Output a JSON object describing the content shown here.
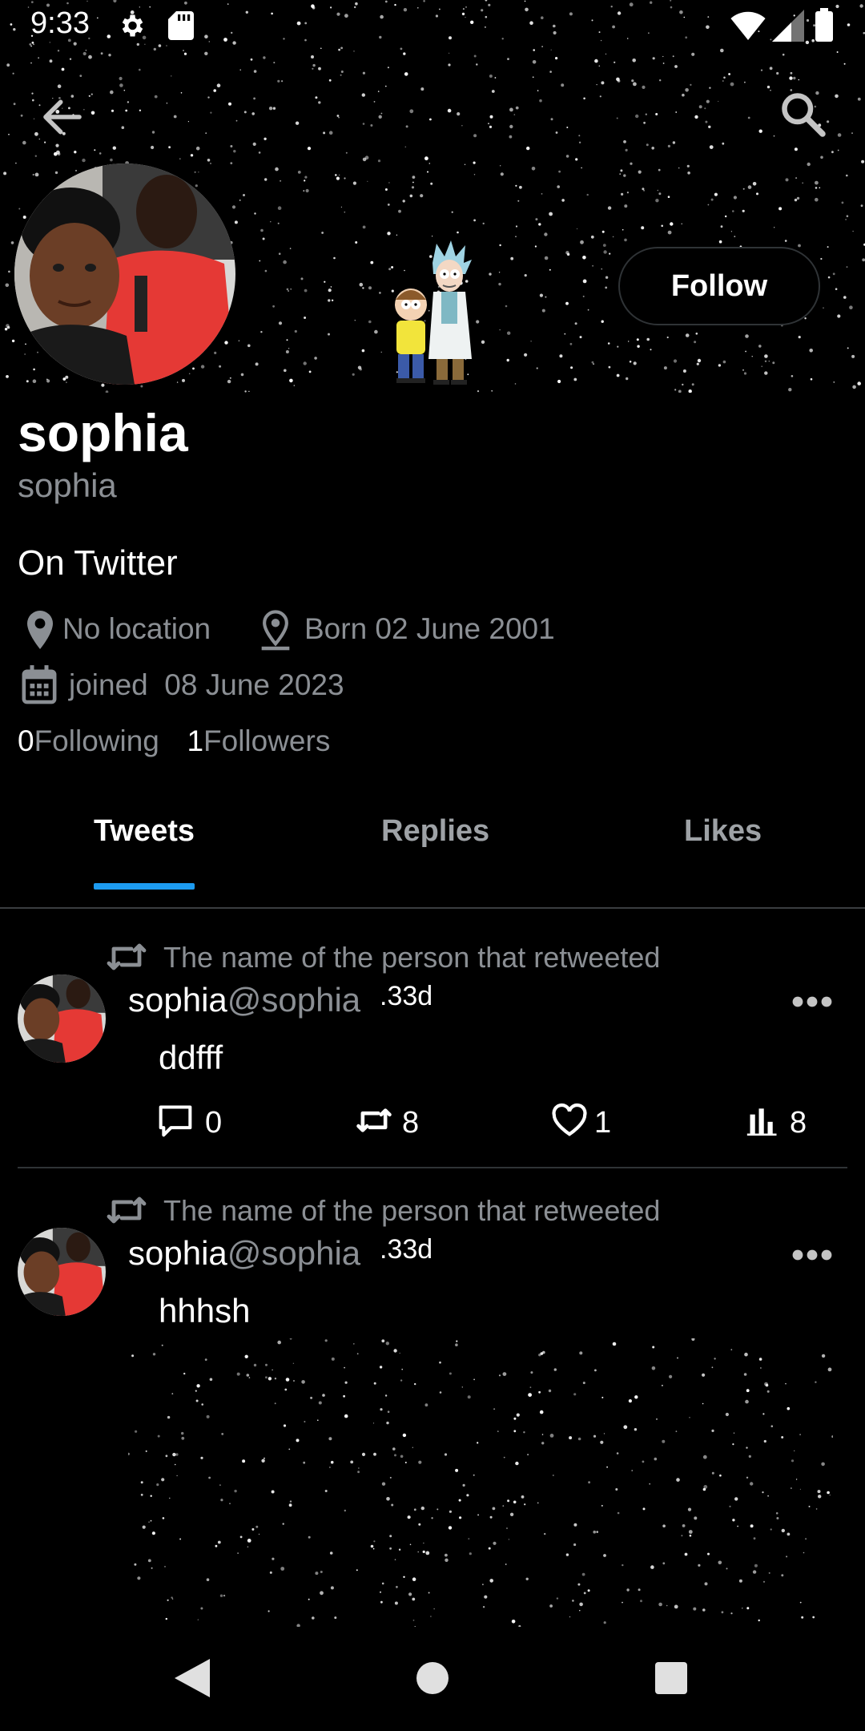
{
  "status_bar": {
    "time": "9:33",
    "icons": [
      "gear-icon",
      "sd-card-icon",
      "wifi-icon",
      "signal-icon",
      "battery-icon"
    ]
  },
  "header": {
    "back_icon": "arrow-left-icon",
    "search_icon": "search-icon"
  },
  "profile": {
    "display_name": "sophia",
    "handle": "sophia",
    "bio": "On Twitter",
    "location": "No location",
    "born": "Born 02 June 2001",
    "joined": "joined  08 June 2023",
    "following_count": "0",
    "following_label": "Following",
    "followers_count": "1",
    "followers_label": "Followers",
    "follow_button": "Follow"
  },
  "tabs": [
    {
      "label": "Tweets",
      "active": true
    },
    {
      "label": "Replies",
      "active": false
    },
    {
      "label": "Likes",
      "active": false
    }
  ],
  "tweets": [
    {
      "retweet_label": "The name of the person that retweeted",
      "name": "sophia",
      "handle": "@sophia",
      "time": ".33d",
      "body": "ddfff",
      "replies": "0",
      "retweets": "8",
      "likes": "1",
      "views": "8"
    },
    {
      "retweet_label": "The name of the person that retweeted",
      "name": "sophia",
      "handle": "@sophia",
      "time": ".33d",
      "body": "hhhsh"
    }
  ],
  "colors": {
    "background": "#000000",
    "accent": "#1d9bf0",
    "secondary_text": "#8b8f94"
  }
}
